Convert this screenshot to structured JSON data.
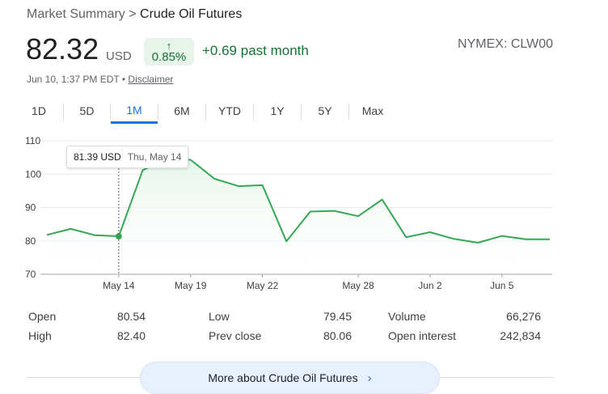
{
  "breadcrumb": {
    "root": "Market Summary",
    "separator": ">",
    "current": "Crude Oil Futures"
  },
  "quote": {
    "price": "82.32",
    "currency": "USD",
    "change_arrow": "↑",
    "change_percent": "0.85%",
    "change_absolute": "+0.69 past month",
    "ticker": "NYMEX: CLW00",
    "timestamp": "Jun 10, 1:37 PM EDT",
    "bullet": "•",
    "disclaimer": "Disclaimer"
  },
  "tabs": [
    "1D",
    "5D",
    "1M",
    "6M",
    "YTD",
    "1Y",
    "5Y",
    "Max"
  ],
  "active_tab": "1M",
  "tooltip": {
    "value": "81.39 USD",
    "date": "Thu, May 14"
  },
  "chart_data": {
    "type": "line",
    "x": [
      "May 10",
      "May 12",
      "May 13",
      "May 14",
      "May 15",
      "May 16",
      "May 19",
      "May 20",
      "May 21",
      "May 22",
      "May 23",
      "May 26",
      "May 27",
      "May 28",
      "May 29",
      "May 30",
      "Jun 2",
      "Jun 3",
      "Jun 4",
      "Jun 5",
      "Jun 6",
      "Jun 9"
    ],
    "values": [
      81.8,
      83.6,
      81.7,
      81.39,
      101.2,
      104.5,
      104.3,
      98.6,
      96.4,
      96.7,
      79.9,
      88.8,
      89.0,
      87.4,
      92.4,
      81.1,
      82.6,
      80.6,
      79.45,
      81.5,
      80.5,
      80.5
    ],
    "xticks": [
      "May 14",
      "May 19",
      "May 22",
      "May 28",
      "Jun 2",
      "Jun 5"
    ],
    "yticks": [
      70,
      80,
      90,
      100,
      110
    ],
    "ylim": [
      70,
      110
    ],
    "highlight_index": 3,
    "grid": true,
    "line_color": "#34a853",
    "fill_color": "#e6f4ea"
  },
  "stats": [
    [
      {
        "label": "Open",
        "value": "80.54"
      },
      {
        "label": "Low",
        "value": "79.45"
      },
      {
        "label": "Volume",
        "value": "66,276"
      }
    ],
    [
      {
        "label": "High",
        "value": "82.40"
      },
      {
        "label": "Prev close",
        "value": "80.06"
      },
      {
        "label": "Open interest",
        "value": "242,834"
      }
    ]
  ],
  "more_button": {
    "label": "More about Crude Oil Futures",
    "chevron": "›"
  },
  "colors": {
    "positive": "#137333",
    "accent": "#1a73e8"
  }
}
